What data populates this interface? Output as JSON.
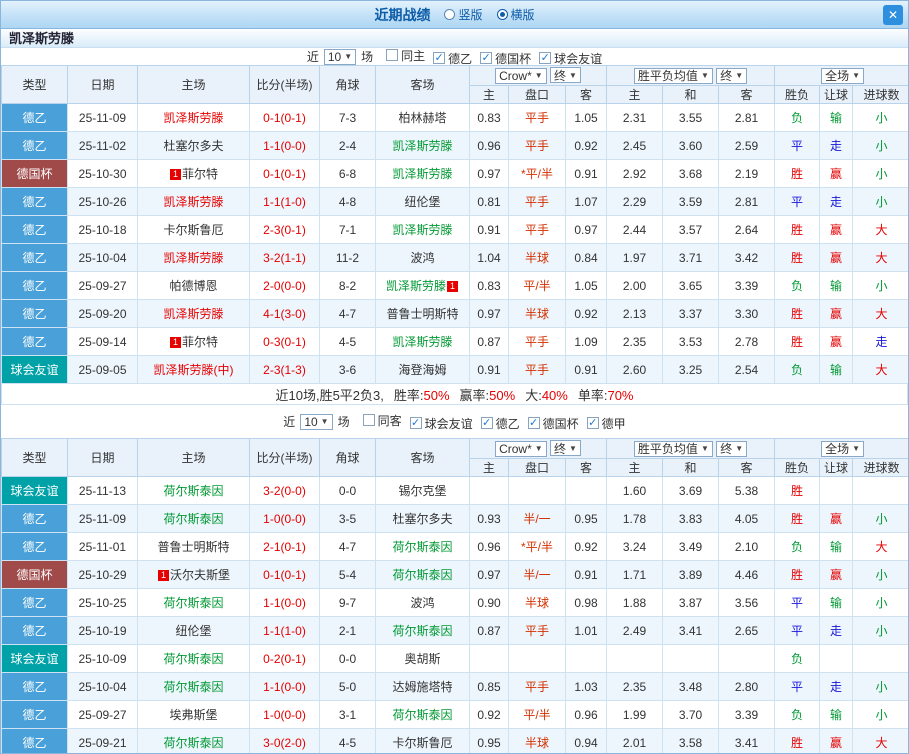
{
  "colors": {
    "accent": "#0d5ca8",
    "de2": "#4aa0d8",
    "cup": "#a04a4a",
    "fr": "#00a2a8",
    "red": "#e60000",
    "blue": "#1515dd",
    "green": "#009933",
    "hcap": "#d43000",
    "score": "#e60000"
  },
  "titlebar": {
    "title": "近期战绩",
    "radio1": "竖版",
    "radio2": "横版",
    "close": "✕"
  },
  "header": {
    "type": "类型",
    "date": "日期",
    "home": "主场",
    "score": "比分(半场)",
    "corner": "角球",
    "away": "客场",
    "odds_src": "Crow*",
    "fin": "终",
    "o_home": "主",
    "o_hcap": "盘口",
    "o_away": "客",
    "avg": "胜平负均值",
    "a_home": "主",
    "a_draw": "和",
    "a_away": "客",
    "full": "全场",
    "r_wdl": "胜负",
    "r_hcap": "让球",
    "r_goals": "进球数"
  },
  "section1": {
    "team": "凯泽斯劳滕",
    "filter": {
      "prefix": "近",
      "count": "10",
      "suffix": "场",
      "options": [
        {
          "label": "同主",
          "checked": false
        },
        {
          "label": "德乙",
          "checked": true
        },
        {
          "label": "德国杯",
          "checked": true
        },
        {
          "label": "球会友谊",
          "checked": true
        }
      ]
    },
    "rows": [
      {
        "lg": "德乙",
        "lgc": "de2",
        "date": "25-11-09",
        "home": [
          "凯泽斯劳滕",
          "red",
          null
        ],
        "score": "0-1(0-1)",
        "cn": "7-3",
        "away": [
          "柏林赫塔",
          "blk",
          null
        ],
        "odds": [
          "0.83",
          "平手",
          "1.05"
        ],
        "avg": [
          "2.31",
          "3.55",
          "2.81"
        ],
        "res": [
          [
            "负",
            "green"
          ],
          [
            "输",
            "green"
          ],
          [
            "小",
            "green"
          ]
        ]
      },
      {
        "lg": "德乙",
        "lgc": "de2",
        "date": "25-11-02",
        "home": [
          "杜塞尔多夫",
          "blk",
          null
        ],
        "score": "1-1(0-0)",
        "cn": "2-4",
        "away": [
          "凯泽斯劳滕",
          "green",
          null
        ],
        "odds": [
          "0.96",
          "平手",
          "0.92"
        ],
        "avg": [
          "2.45",
          "3.60",
          "2.59"
        ],
        "res": [
          [
            "平",
            "blue"
          ],
          [
            "走",
            "blue"
          ],
          [
            "小",
            "green"
          ]
        ]
      },
      {
        "lg": "德国杯",
        "lgc": "cup",
        "date": "25-10-30",
        "home": [
          "菲尔特",
          "blk",
          "b"
        ],
        "score": "0-1(0-1)",
        "cn": "6-8",
        "away": [
          "凯泽斯劳滕",
          "green",
          null
        ],
        "odds": [
          "0.97",
          "*平/半",
          "0.91"
        ],
        "avg": [
          "2.92",
          "3.68",
          "2.19"
        ],
        "res": [
          [
            "胜",
            "red"
          ],
          [
            "赢",
            "red"
          ],
          [
            "小",
            "green"
          ]
        ]
      },
      {
        "lg": "德乙",
        "lgc": "de2",
        "date": "25-10-26",
        "home": [
          "凯泽斯劳滕",
          "red",
          null
        ],
        "score": "1-1(1-0)",
        "cn": "4-8",
        "away": [
          "纽伦堡",
          "blk",
          null
        ],
        "odds": [
          "0.81",
          "平手",
          "1.07"
        ],
        "avg": [
          "2.29",
          "3.59",
          "2.81"
        ],
        "res": [
          [
            "平",
            "blue"
          ],
          [
            "走",
            "blue"
          ],
          [
            "小",
            "green"
          ]
        ]
      },
      {
        "lg": "德乙",
        "lgc": "de2",
        "date": "25-10-18",
        "home": [
          "卡尔斯鲁厄",
          "blk",
          null
        ],
        "score": "2-3(0-1)",
        "cn": "7-1",
        "away": [
          "凯泽斯劳滕",
          "green",
          null
        ],
        "odds": [
          "0.91",
          "平手",
          "0.97"
        ],
        "avg": [
          "2.44",
          "3.57",
          "2.64"
        ],
        "res": [
          [
            "胜",
            "red"
          ],
          [
            "赢",
            "red"
          ],
          [
            "大",
            "red"
          ]
        ]
      },
      {
        "lg": "德乙",
        "lgc": "de2",
        "date": "25-10-04",
        "home": [
          "凯泽斯劳滕",
          "red",
          null
        ],
        "score": "3-2(1-1)",
        "cn": "11-2",
        "away": [
          "波鸿",
          "blk",
          null
        ],
        "odds": [
          "1.04",
          "半球",
          "0.84"
        ],
        "avg": [
          "1.97",
          "3.71",
          "3.42"
        ],
        "res": [
          [
            "胜",
            "red"
          ],
          [
            "赢",
            "red"
          ],
          [
            "大",
            "red"
          ]
        ]
      },
      {
        "lg": "德乙",
        "lgc": "de2",
        "date": "25-09-27",
        "home": [
          "帕德博恩",
          "blk",
          null
        ],
        "score": "2-0(0-0)",
        "cn": "8-2",
        "away": [
          "凯泽斯劳滕",
          "green",
          "a"
        ],
        "odds": [
          "0.83",
          "平/半",
          "1.05"
        ],
        "avg": [
          "2.00",
          "3.65",
          "3.39"
        ],
        "res": [
          [
            "负",
            "green"
          ],
          [
            "输",
            "green"
          ],
          [
            "小",
            "green"
          ]
        ]
      },
      {
        "lg": "德乙",
        "lgc": "de2",
        "date": "25-09-20",
        "home": [
          "凯泽斯劳滕",
          "red",
          null
        ],
        "score": "4-1(3-0)",
        "cn": "4-7",
        "away": [
          "普鲁士明斯特",
          "blk",
          null
        ],
        "odds": [
          "0.97",
          "半球",
          "0.92"
        ],
        "avg": [
          "2.13",
          "3.37",
          "3.30"
        ],
        "res": [
          [
            "胜",
            "red"
          ],
          [
            "赢",
            "red"
          ],
          [
            "大",
            "red"
          ]
        ]
      },
      {
        "lg": "德乙",
        "lgc": "de2",
        "date": "25-09-14",
        "home": [
          "菲尔特",
          "blk",
          "b"
        ],
        "score": "0-3(0-1)",
        "cn": "4-5",
        "away": [
          "凯泽斯劳滕",
          "green",
          null
        ],
        "odds": [
          "0.87",
          "平手",
          "1.09"
        ],
        "avg": [
          "2.35",
          "3.53",
          "2.78"
        ],
        "res": [
          [
            "胜",
            "red"
          ],
          [
            "赢",
            "red"
          ],
          [
            "走",
            "blue"
          ]
        ]
      },
      {
        "lg": "球会友谊",
        "lgc": "fr",
        "date": "25-09-05",
        "home": [
          "凯泽斯劳滕(中)",
          "red",
          null
        ],
        "score": "2-3(1-3)",
        "cn": "3-6",
        "away": [
          "海登海姆",
          "blk",
          null
        ],
        "odds": [
          "0.91",
          "平手",
          "0.91"
        ],
        "avg": [
          "2.60",
          "3.25",
          "2.54"
        ],
        "res": [
          [
            "负",
            "green"
          ],
          [
            "输",
            "green"
          ],
          [
            "大",
            "red"
          ]
        ]
      }
    ],
    "summary": {
      "lead": "近10场,胜5平2负3,",
      "stats": [
        {
          "label": "胜率:",
          "value": "50%"
        },
        {
          "label": "赢率:",
          "value": "50%"
        },
        {
          "label": "大:",
          "value": "40%"
        },
        {
          "label": "单率:",
          "value": "70%"
        }
      ]
    }
  },
  "section2": {
    "filter": {
      "prefix": "近",
      "count": "10",
      "suffix": "场",
      "options": [
        {
          "label": "同客",
          "checked": false
        },
        {
          "label": "球会友谊",
          "checked": true
        },
        {
          "label": "德乙",
          "checked": true
        },
        {
          "label": "德国杯",
          "checked": true
        },
        {
          "label": "德甲",
          "checked": true
        }
      ]
    },
    "rows": [
      {
        "lg": "球会友谊",
        "lgc": "fr",
        "date": "25-11-13",
        "home": [
          "荷尔斯泰因",
          "green",
          null
        ],
        "score": "3-2(0-0)",
        "cn": "0-0",
        "away": [
          "锡尔克堡",
          "blk",
          null
        ],
        "odds": [
          "",
          "",
          ""
        ],
        "avg": [
          "1.60",
          "3.69",
          "5.38"
        ],
        "res": [
          [
            "胜",
            "red"
          ],
          [
            "",
            ""
          ],
          [
            "",
            ""
          ]
        ]
      },
      {
        "lg": "德乙",
        "lgc": "de2",
        "date": "25-11-09",
        "home": [
          "荷尔斯泰因",
          "green",
          null
        ],
        "score": "1-0(0-0)",
        "cn": "3-5",
        "away": [
          "杜塞尔多夫",
          "blk",
          null
        ],
        "odds": [
          "0.93",
          "半/一",
          "0.95"
        ],
        "avg": [
          "1.78",
          "3.83",
          "4.05"
        ],
        "res": [
          [
            "胜",
            "red"
          ],
          [
            "赢",
            "red"
          ],
          [
            "小",
            "green"
          ]
        ]
      },
      {
        "lg": "德乙",
        "lgc": "de2",
        "date": "25-11-01",
        "home": [
          "普鲁士明斯特",
          "blk",
          null
        ],
        "score": "2-1(0-1)",
        "cn": "4-7",
        "away": [
          "荷尔斯泰因",
          "green",
          null
        ],
        "odds": [
          "0.96",
          "*平/半",
          "0.92"
        ],
        "avg": [
          "3.24",
          "3.49",
          "2.10"
        ],
        "res": [
          [
            "负",
            "green"
          ],
          [
            "输",
            "green"
          ],
          [
            "大",
            "red"
          ]
        ]
      },
      {
        "lg": "德国杯",
        "lgc": "cup",
        "date": "25-10-29",
        "home": [
          "沃尔夫斯堡",
          "blk",
          "b"
        ],
        "score": "0-1(0-1)",
        "cn": "5-4",
        "away": [
          "荷尔斯泰因",
          "green",
          null
        ],
        "odds": [
          "0.97",
          "半/一",
          "0.91"
        ],
        "avg": [
          "1.71",
          "3.89",
          "4.46"
        ],
        "res": [
          [
            "胜",
            "red"
          ],
          [
            "赢",
            "red"
          ],
          [
            "小",
            "green"
          ]
        ]
      },
      {
        "lg": "德乙",
        "lgc": "de2",
        "date": "25-10-25",
        "home": [
          "荷尔斯泰因",
          "green",
          null
        ],
        "score": "1-1(0-0)",
        "cn": "9-7",
        "away": [
          "波鸿",
          "blk",
          null
        ],
        "odds": [
          "0.90",
          "半球",
          "0.98"
        ],
        "avg": [
          "1.88",
          "3.87",
          "3.56"
        ],
        "res": [
          [
            "平",
            "blue"
          ],
          [
            "输",
            "green"
          ],
          [
            "小",
            "green"
          ]
        ]
      },
      {
        "lg": "德乙",
        "lgc": "de2",
        "date": "25-10-19",
        "home": [
          "纽伦堡",
          "blk",
          null
        ],
        "score": "1-1(1-0)",
        "cn": "2-1",
        "away": [
          "荷尔斯泰因",
          "green",
          null
        ],
        "odds": [
          "0.87",
          "平手",
          "1.01"
        ],
        "avg": [
          "2.49",
          "3.41",
          "2.65"
        ],
        "res": [
          [
            "平",
            "blue"
          ],
          [
            "走",
            "blue"
          ],
          [
            "小",
            "green"
          ]
        ]
      },
      {
        "lg": "球会友谊",
        "lgc": "fr",
        "date": "25-10-09",
        "home": [
          "荷尔斯泰因",
          "green",
          null
        ],
        "score": "0-2(0-1)",
        "cn": "0-0",
        "away": [
          "奥胡斯",
          "blk",
          null
        ],
        "odds": [
          "",
          "",
          ""
        ],
        "avg": [
          "",
          "",
          ""
        ],
        "res": [
          [
            "负",
            "green"
          ],
          [
            "",
            ""
          ],
          [
            "",
            ""
          ]
        ]
      },
      {
        "lg": "德乙",
        "lgc": "de2",
        "date": "25-10-04",
        "home": [
          "荷尔斯泰因",
          "green",
          null
        ],
        "score": "1-1(0-0)",
        "cn": "5-0",
        "away": [
          "达姆施塔特",
          "blk",
          null
        ],
        "odds": [
          "0.85",
          "平手",
          "1.03"
        ],
        "avg": [
          "2.35",
          "3.48",
          "2.80"
        ],
        "res": [
          [
            "平",
            "blue"
          ],
          [
            "走",
            "blue"
          ],
          [
            "小",
            "green"
          ]
        ]
      },
      {
        "lg": "德乙",
        "lgc": "de2",
        "date": "25-09-27",
        "home": [
          "埃弗斯堡",
          "blk",
          null
        ],
        "score": "1-0(0-0)",
        "cn": "3-1",
        "away": [
          "荷尔斯泰因",
          "green",
          null
        ],
        "odds": [
          "0.92",
          "平/半",
          "0.96"
        ],
        "avg": [
          "1.99",
          "3.70",
          "3.39"
        ],
        "res": [
          [
            "负",
            "green"
          ],
          [
            "输",
            "green"
          ],
          [
            "小",
            "green"
          ]
        ]
      },
      {
        "lg": "德乙",
        "lgc": "de2",
        "date": "25-09-21",
        "home": [
          "荷尔斯泰因",
          "green",
          null
        ],
        "score": "3-0(2-0)",
        "cn": "4-5",
        "away": [
          "卡尔斯鲁厄",
          "blk",
          null
        ],
        "odds": [
          "0.95",
          "半球",
          "0.94"
        ],
        "avg": [
          "2.01",
          "3.58",
          "3.41"
        ],
        "res": [
          [
            "胜",
            "red"
          ],
          [
            "赢",
            "red"
          ],
          [
            "大",
            "red"
          ]
        ]
      }
    ]
  }
}
